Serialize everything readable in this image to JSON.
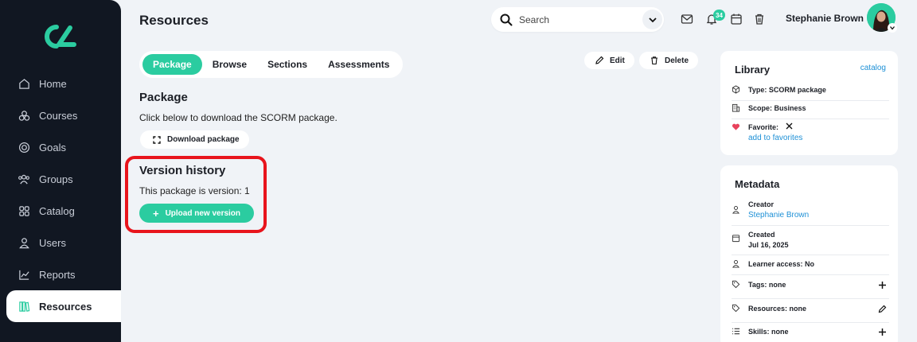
{
  "sidebar": {
    "items": [
      {
        "label": "Home",
        "icon": "home-icon"
      },
      {
        "label": "Courses",
        "icon": "courses-icon"
      },
      {
        "label": "Goals",
        "icon": "goals-icon"
      },
      {
        "label": "Groups",
        "icon": "groups-icon"
      },
      {
        "label": "Catalog",
        "icon": "catalog-icon"
      },
      {
        "label": "Users",
        "icon": "users-icon"
      },
      {
        "label": "Reports",
        "icon": "reports-icon"
      },
      {
        "label": "Resources",
        "icon": "resources-icon"
      }
    ],
    "active_index": 7
  },
  "header": {
    "title": "Resources",
    "search_placeholder": "Search",
    "notification_count": "34",
    "user_name": "Stephanie Brown"
  },
  "tabs": [
    "Package",
    "Browse",
    "Sections",
    "Assessments"
  ],
  "actions": {
    "edit": "Edit",
    "delete": "Delete"
  },
  "package": {
    "title": "Package",
    "description": "Click below to download the SCORM package.",
    "download_label": "Download package"
  },
  "version": {
    "title": "Version history",
    "text": "This package is version: 1",
    "upload_label": "Upload new version"
  },
  "library": {
    "title": "Library",
    "link": "catalog",
    "type": "Type: SCORM package",
    "scope": "Scope: Business",
    "favorite_label": "Favorite:",
    "favorite_link": "add to favorites"
  },
  "metadata": {
    "title": "Metadata",
    "creator_label": "Creator",
    "creator_value": "Stephanie Brown",
    "created_label": "Created",
    "created_value": "Jul 16, 2025",
    "learner_access": "Learner access: No",
    "tags": "Tags: none",
    "resources": "Resources: none",
    "skills": "Skills:  none"
  },
  "colors": {
    "accent": "#2bcca0",
    "sidebar": "#111722",
    "highlight": "#e8141c",
    "link": "#1e90d6"
  }
}
